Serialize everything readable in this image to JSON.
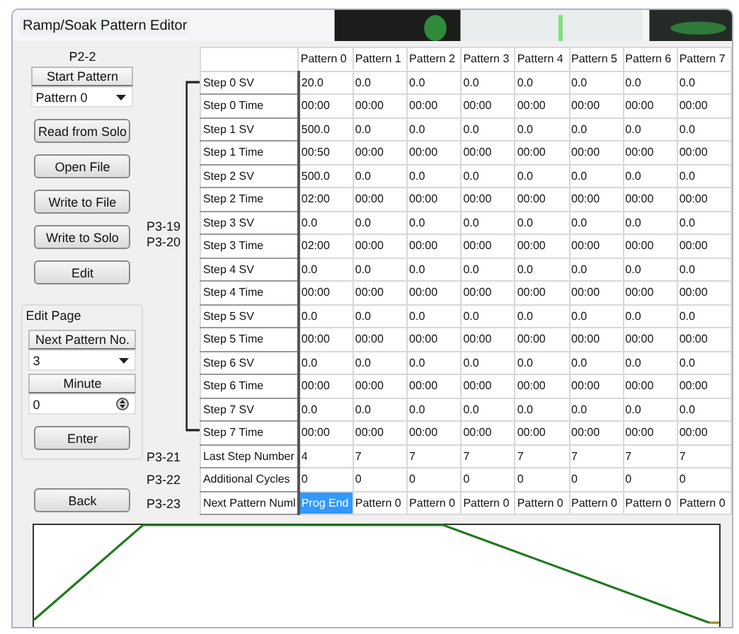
{
  "window": {
    "title": "Ramp/Soak Pattern Editor"
  },
  "left_panel": {
    "code": "P2-2",
    "start_pattern": {
      "label": "Start Pattern",
      "value": "Pattern 0"
    },
    "buttons": [
      "Read from Solo",
      "Open File",
      "Write to File",
      "Write to Solo",
      "Edit"
    ],
    "edit_page": {
      "title": "Edit Page",
      "next_pattern": {
        "label": "Next Pattern No.",
        "value": "3"
      },
      "minute": {
        "label": "Minute",
        "value": "0"
      },
      "enter": "Enter"
    },
    "back": "Back"
  },
  "codes": {
    "step_block": [
      "P3-19",
      "P3-20"
    ],
    "rows": [
      "P3-21",
      "P3-22",
      "P3-23"
    ]
  },
  "table": {
    "columns": [
      "Pattern 0",
      "Pattern 1",
      "Pattern 2",
      "Pattern 3",
      "Pattern 4",
      "Pattern 5",
      "Pattern 6",
      "Pattern 7"
    ],
    "rows": [
      {
        "label": "Step 0 SV",
        "cells": [
          {
            "text": "20.0",
            "selected": false
          },
          {
            "text": "0.0",
            "selected": false
          },
          {
            "text": "0.0",
            "selected": false
          },
          {
            "text": "0.0",
            "selected": false
          },
          {
            "text": "0.0",
            "selected": false
          },
          {
            "text": "0.0",
            "selected": false
          },
          {
            "text": "0.0",
            "selected": false
          },
          {
            "text": "0.0",
            "selected": false
          }
        ]
      },
      {
        "label": "Step 0 Time",
        "cells": [
          {
            "text": "00:00",
            "selected": false
          },
          {
            "text": "00:00",
            "selected": false
          },
          {
            "text": "00:00",
            "selected": false
          },
          {
            "text": "00:00",
            "selected": false
          },
          {
            "text": "00:00",
            "selected": false
          },
          {
            "text": "00:00",
            "selected": false
          },
          {
            "text": "00:00",
            "selected": false
          },
          {
            "text": "00:00",
            "selected": false
          }
        ]
      },
      {
        "label": "Step 1 SV",
        "cells": [
          {
            "text": "500.0",
            "selected": false
          },
          {
            "text": "0.0",
            "selected": false
          },
          {
            "text": "0.0",
            "selected": false
          },
          {
            "text": "0.0",
            "selected": false
          },
          {
            "text": "0.0",
            "selected": false
          },
          {
            "text": "0.0",
            "selected": false
          },
          {
            "text": "0.0",
            "selected": false
          },
          {
            "text": "0.0",
            "selected": false
          }
        ]
      },
      {
        "label": "Step 1 Time",
        "cells": [
          {
            "text": "00:50",
            "selected": false
          },
          {
            "text": "00:00",
            "selected": false
          },
          {
            "text": "00:00",
            "selected": false
          },
          {
            "text": "00:00",
            "selected": false
          },
          {
            "text": "00:00",
            "selected": false
          },
          {
            "text": "00:00",
            "selected": false
          },
          {
            "text": "00:00",
            "selected": false
          },
          {
            "text": "00:00",
            "selected": false
          }
        ]
      },
      {
        "label": "Step 2 SV",
        "cells": [
          {
            "text": "500.0",
            "selected": false
          },
          {
            "text": "0.0",
            "selected": false
          },
          {
            "text": "0.0",
            "selected": false
          },
          {
            "text": "0.0",
            "selected": false
          },
          {
            "text": "0.0",
            "selected": false
          },
          {
            "text": "0.0",
            "selected": false
          },
          {
            "text": "0.0",
            "selected": false
          },
          {
            "text": "0.0",
            "selected": false
          }
        ]
      },
      {
        "label": "Step 2 Time",
        "cells": [
          {
            "text": "02:00",
            "selected": false
          },
          {
            "text": "00:00",
            "selected": false
          },
          {
            "text": "00:00",
            "selected": false
          },
          {
            "text": "00:00",
            "selected": false
          },
          {
            "text": "00:00",
            "selected": false
          },
          {
            "text": "00:00",
            "selected": false
          },
          {
            "text": "00:00",
            "selected": false
          },
          {
            "text": "00:00",
            "selected": false
          }
        ]
      },
      {
        "label": "Step 3 SV",
        "cells": [
          {
            "text": "0.0",
            "selected": false
          },
          {
            "text": "0.0",
            "selected": false
          },
          {
            "text": "0.0",
            "selected": false
          },
          {
            "text": "0.0",
            "selected": false
          },
          {
            "text": "0.0",
            "selected": false
          },
          {
            "text": "0.0",
            "selected": false
          },
          {
            "text": "0.0",
            "selected": false
          },
          {
            "text": "0.0",
            "selected": false
          }
        ]
      },
      {
        "label": "Step 3 Time",
        "cells": [
          {
            "text": "02:00",
            "selected": false
          },
          {
            "text": "00:00",
            "selected": false
          },
          {
            "text": "00:00",
            "selected": false
          },
          {
            "text": "00:00",
            "selected": false
          },
          {
            "text": "00:00",
            "selected": false
          },
          {
            "text": "00:00",
            "selected": false
          },
          {
            "text": "00:00",
            "selected": false
          },
          {
            "text": "00:00",
            "selected": false
          }
        ]
      },
      {
        "label": "Step 4 SV",
        "cells": [
          {
            "text": "0.0",
            "selected": false
          },
          {
            "text": "0.0",
            "selected": false
          },
          {
            "text": "0.0",
            "selected": false
          },
          {
            "text": "0.0",
            "selected": false
          },
          {
            "text": "0.0",
            "selected": false
          },
          {
            "text": "0.0",
            "selected": false
          },
          {
            "text": "0.0",
            "selected": false
          },
          {
            "text": "0.0",
            "selected": false
          }
        ]
      },
      {
        "label": "Step 4 Time",
        "cells": [
          {
            "text": "00:00",
            "selected": false
          },
          {
            "text": "00:00",
            "selected": false
          },
          {
            "text": "00:00",
            "selected": false
          },
          {
            "text": "00:00",
            "selected": false
          },
          {
            "text": "00:00",
            "selected": false
          },
          {
            "text": "00:00",
            "selected": false
          },
          {
            "text": "00:00",
            "selected": false
          },
          {
            "text": "00:00",
            "selected": false
          }
        ]
      },
      {
        "label": "Step 5 SV",
        "cells": [
          {
            "text": "0.0",
            "selected": false
          },
          {
            "text": "0.0",
            "selected": false
          },
          {
            "text": "0.0",
            "selected": false
          },
          {
            "text": "0.0",
            "selected": false
          },
          {
            "text": "0.0",
            "selected": false
          },
          {
            "text": "0.0",
            "selected": false
          },
          {
            "text": "0.0",
            "selected": false
          },
          {
            "text": "0.0",
            "selected": false
          }
        ]
      },
      {
        "label": "Step 5 Time",
        "cells": [
          {
            "text": "00:00",
            "selected": false
          },
          {
            "text": "00:00",
            "selected": false
          },
          {
            "text": "00:00",
            "selected": false
          },
          {
            "text": "00:00",
            "selected": false
          },
          {
            "text": "00:00",
            "selected": false
          },
          {
            "text": "00:00",
            "selected": false
          },
          {
            "text": "00:00",
            "selected": false
          },
          {
            "text": "00:00",
            "selected": false
          }
        ]
      },
      {
        "label": "Step 6 SV",
        "cells": [
          {
            "text": "0.0",
            "selected": false
          },
          {
            "text": "0.0",
            "selected": false
          },
          {
            "text": "0.0",
            "selected": false
          },
          {
            "text": "0.0",
            "selected": false
          },
          {
            "text": "0.0",
            "selected": false
          },
          {
            "text": "0.0",
            "selected": false
          },
          {
            "text": "0.0",
            "selected": false
          },
          {
            "text": "0.0",
            "selected": false
          }
        ]
      },
      {
        "label": "Step 6 Time",
        "cells": [
          {
            "text": "00:00",
            "selected": false
          },
          {
            "text": "00:00",
            "selected": false
          },
          {
            "text": "00:00",
            "selected": false
          },
          {
            "text": "00:00",
            "selected": false
          },
          {
            "text": "00:00",
            "selected": false
          },
          {
            "text": "00:00",
            "selected": false
          },
          {
            "text": "00:00",
            "selected": false
          },
          {
            "text": "00:00",
            "selected": false
          }
        ]
      },
      {
        "label": "Step 7 SV",
        "cells": [
          {
            "text": "0.0",
            "selected": false
          },
          {
            "text": "0.0",
            "selected": false
          },
          {
            "text": "0.0",
            "selected": false
          },
          {
            "text": "0.0",
            "selected": false
          },
          {
            "text": "0.0",
            "selected": false
          },
          {
            "text": "0.0",
            "selected": false
          },
          {
            "text": "0.0",
            "selected": false
          },
          {
            "text": "0.0",
            "selected": false
          }
        ]
      },
      {
        "label": "Step 7 Time",
        "cells": [
          {
            "text": "00:00",
            "selected": false
          },
          {
            "text": "00:00",
            "selected": false
          },
          {
            "text": "00:00",
            "selected": false
          },
          {
            "text": "00:00",
            "selected": false
          },
          {
            "text": "00:00",
            "selected": false
          },
          {
            "text": "00:00",
            "selected": false
          },
          {
            "text": "00:00",
            "selected": false
          },
          {
            "text": "00:00",
            "selected": false
          }
        ]
      },
      {
        "label": "Last Step Number",
        "cells": [
          {
            "text": "4",
            "selected": false
          },
          {
            "text": "7",
            "selected": false
          },
          {
            "text": "7",
            "selected": false
          },
          {
            "text": "7",
            "selected": false
          },
          {
            "text": "7",
            "selected": false
          },
          {
            "text": "7",
            "selected": false
          },
          {
            "text": "7",
            "selected": false
          },
          {
            "text": "7",
            "selected": false
          }
        ]
      },
      {
        "label": "Additional Cycles",
        "cells": [
          {
            "text": "0",
            "selected": false
          },
          {
            "text": "0",
            "selected": false
          },
          {
            "text": "0",
            "selected": false
          },
          {
            "text": "0",
            "selected": false
          },
          {
            "text": "0",
            "selected": false
          },
          {
            "text": "0",
            "selected": false
          },
          {
            "text": "0",
            "selected": false
          },
          {
            "text": "0",
            "selected": false
          }
        ]
      },
      {
        "label": "Next Pattern Numl",
        "cells": [
          {
            "text": "Prog End",
            "selected": true
          },
          {
            "text": "Pattern 0",
            "selected": false
          },
          {
            "text": "Pattern 0",
            "selected": false
          },
          {
            "text": "Pattern 0",
            "selected": false
          },
          {
            "text": "Pattern 0",
            "selected": false
          },
          {
            "text": "Pattern 0",
            "selected": false
          },
          {
            "text": "Pattern 0",
            "selected": false
          },
          {
            "text": "Pattern 0",
            "selected": false
          }
        ]
      }
    ]
  }
}
